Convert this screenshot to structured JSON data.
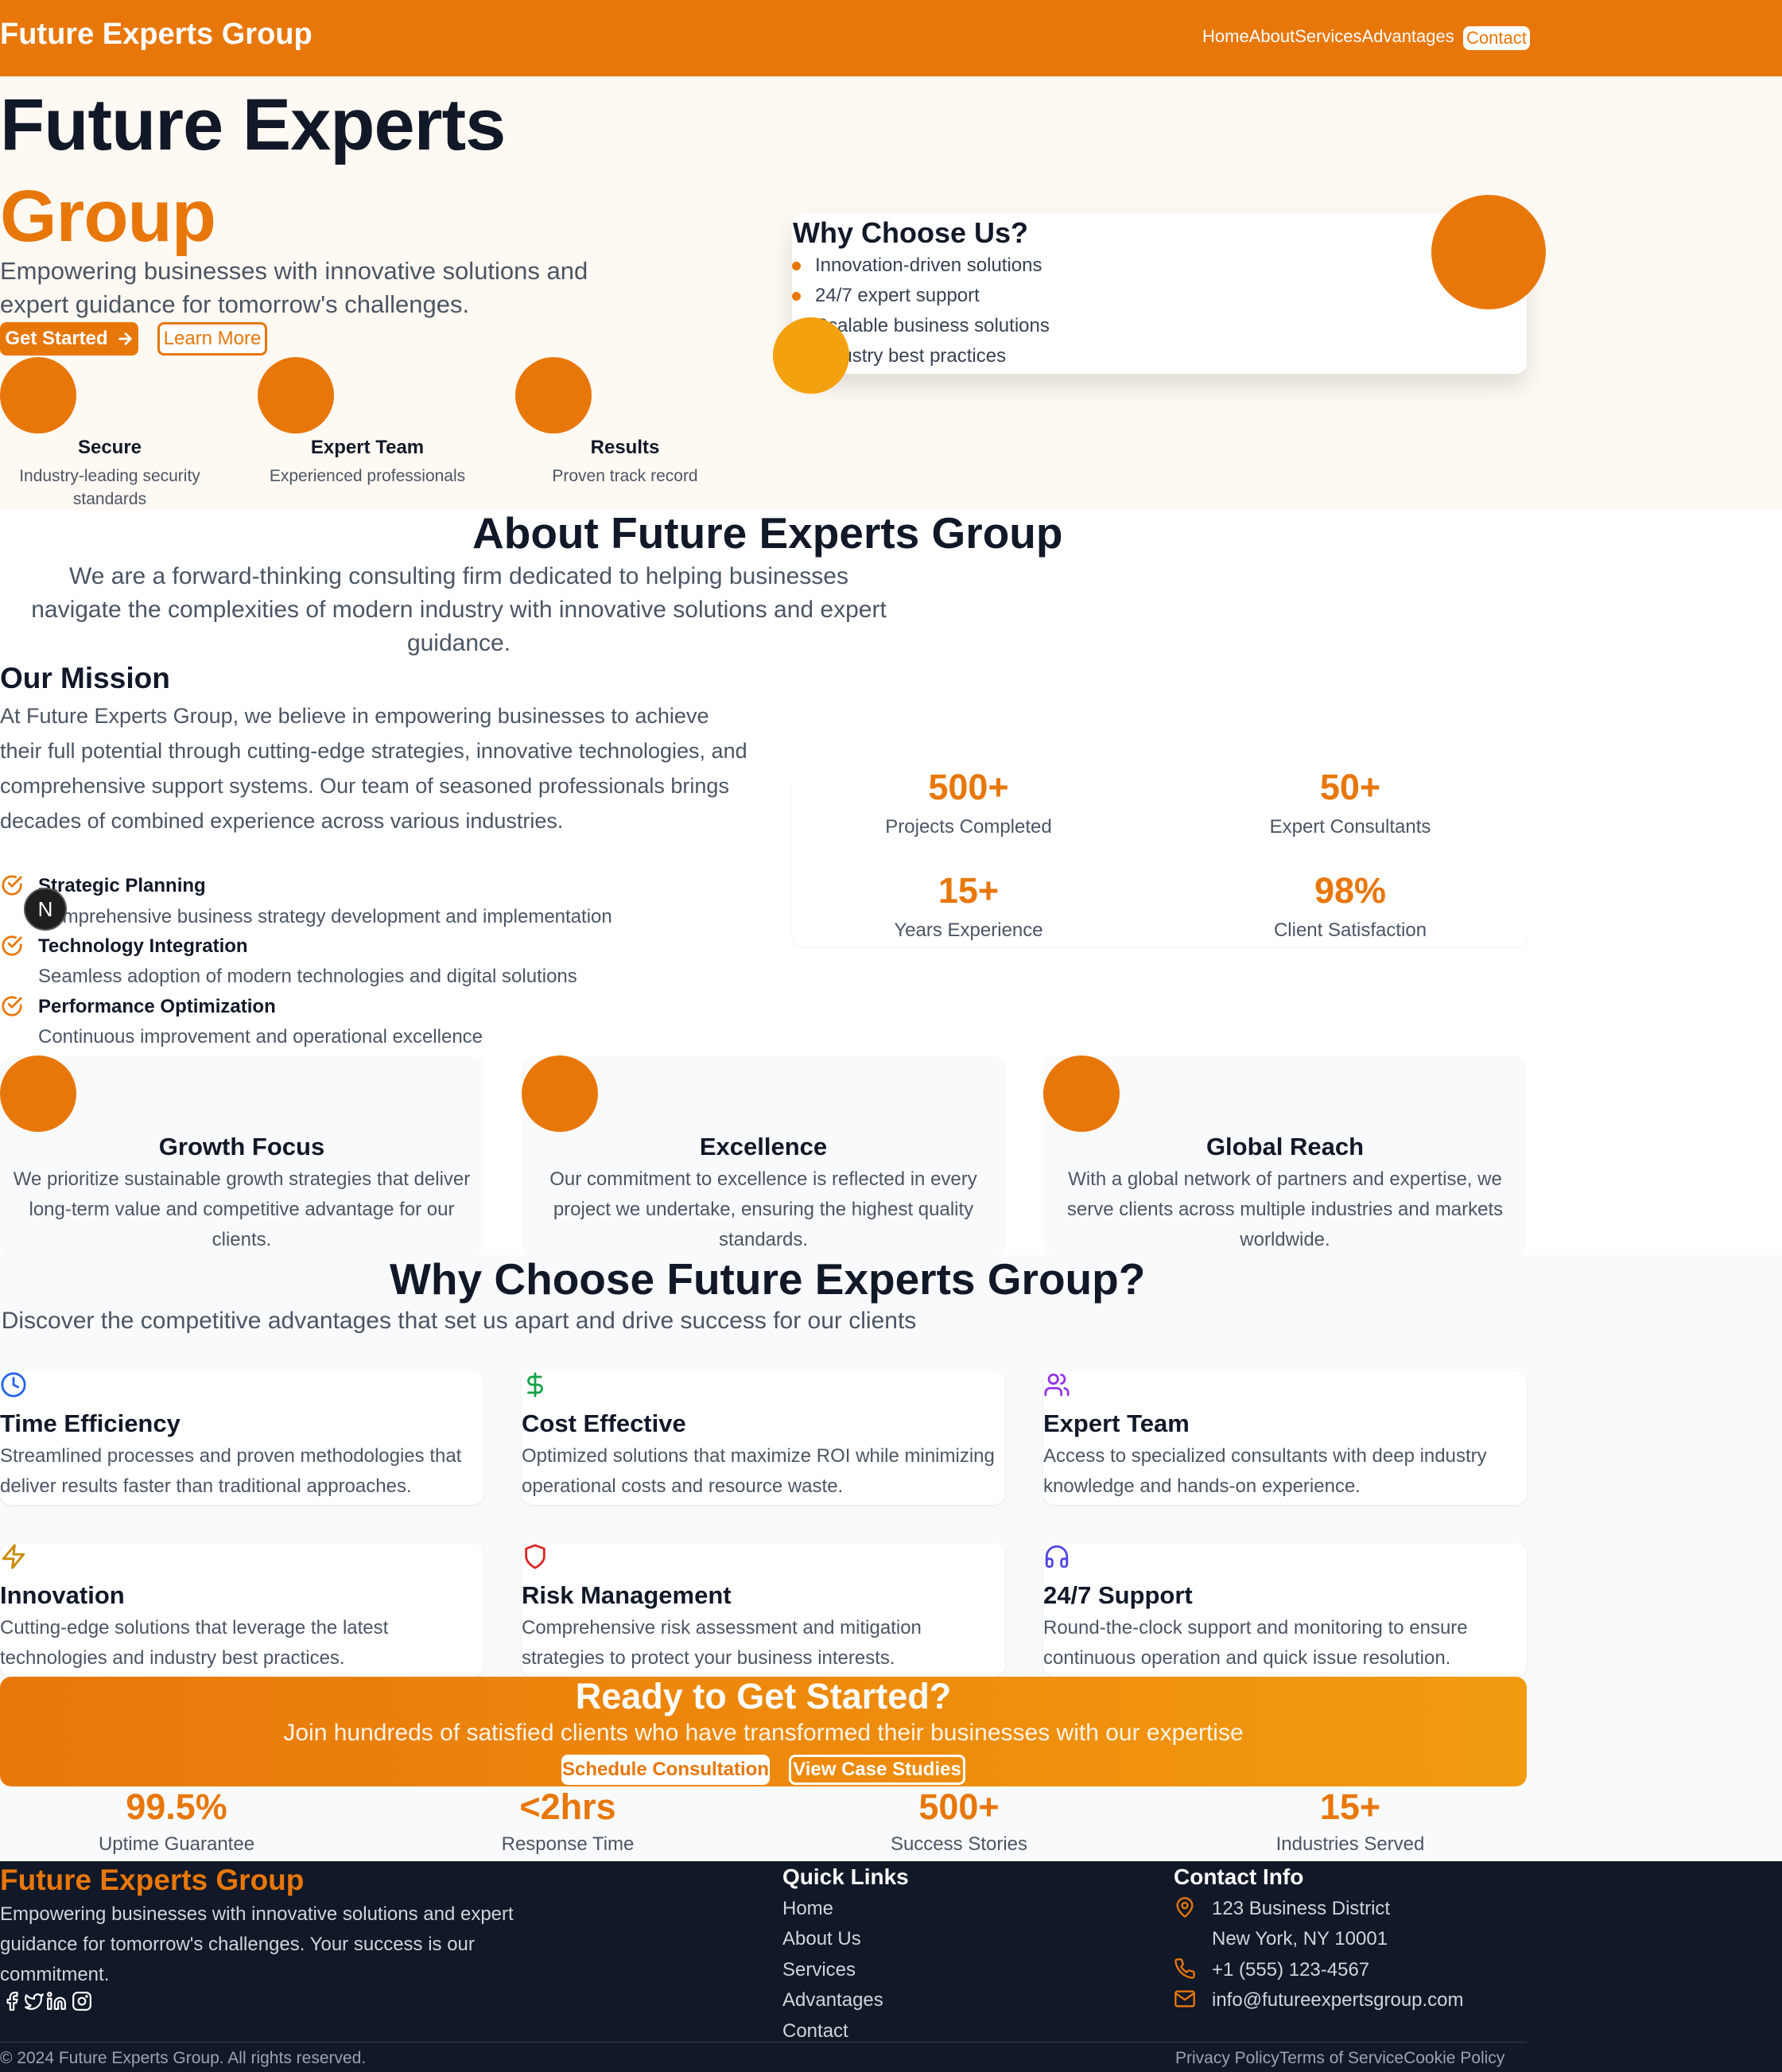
{
  "nav": {
    "brand": "Future Experts Group",
    "links": [
      "Home",
      "About",
      "Services",
      "Advantages"
    ],
    "contact": "Contact"
  },
  "hero": {
    "title_line1": "Future Experts",
    "title_line2": "Group",
    "subtitle": "Empowering businesses with innovative solutions and expert guidance for tomorrow's challenges.",
    "primary_button": "Get Started",
    "secondary_button": "Learn More",
    "features": [
      {
        "title": "Secure",
        "desc": "Industry-leading security standards"
      },
      {
        "title": "Expert Team",
        "desc": "Experienced professionals"
      },
      {
        "title": "Results",
        "desc": "Proven track record"
      }
    ],
    "why_card": {
      "title": "Why Choose Us?",
      "items": [
        "Innovation-driven solutions",
        "24/7 expert support",
        "Scalable business solutions",
        "Industry best practices"
      ]
    }
  },
  "about": {
    "title": "About Future Experts Group",
    "lead": "We are a forward-thinking consulting firm dedicated to helping businesses navigate the complexities of modern industry with innovative solutions and expert guidance.",
    "mission_title": "Our Mission",
    "mission_text": "At Future Experts Group, we believe in empowering businesses to achieve their full potential through cutting-edge strategies, innovative technologies, and comprehensive support systems. Our team of seasoned professionals brings decades of combined experience across various industries.",
    "list": [
      {
        "title": "Strategic Planning",
        "desc": "Comprehensive business strategy development and implementation"
      },
      {
        "title": "Technology Integration",
        "desc": "Seamless adoption of modern technologies and digital solutions"
      },
      {
        "title": "Performance Optimization",
        "desc": "Continuous improvement and operational excellence"
      }
    ],
    "stats": [
      {
        "value": "500+",
        "label": "Projects Completed"
      },
      {
        "value": "50+",
        "label": "Expert Consultants"
      },
      {
        "value": "15+",
        "label": "Years Experience"
      },
      {
        "value": "98%",
        "label": "Client Satisfaction"
      }
    ],
    "values": [
      {
        "title": "Growth Focus",
        "desc": "We prioritize sustainable growth strategies that deliver long-term value and competitive advantage for our clients."
      },
      {
        "title": "Excellence",
        "desc": "Our commitment to excellence is reflected in every project we undertake, ensuring the highest quality standards."
      },
      {
        "title": "Global Reach",
        "desc": "With a global network of partners and expertise, we serve clients across multiple industries and markets worldwide."
      }
    ]
  },
  "advantages": {
    "title": "Why Choose Future Experts Group?",
    "lead": "Discover the competitive advantages that set us apart and drive success for our clients",
    "cards": [
      {
        "icon": "clock-icon",
        "color": "#2563eb",
        "title": "Time Efficiency",
        "desc": "Streamlined processes and proven methodologies that deliver results faster than traditional approaches."
      },
      {
        "icon": "dollar-icon",
        "color": "#16a34a",
        "title": "Cost Effective",
        "desc": "Optimized solutions that maximize ROI while minimizing operational costs and resource waste."
      },
      {
        "icon": "users-icon",
        "color": "#9333ea",
        "title": "Expert Team",
        "desc": "Access to specialized consultants with deep industry knowledge and hands-on experience."
      },
      {
        "icon": "zap-icon",
        "color": "#ca8a04",
        "title": "Innovation",
        "desc": "Cutting-edge solutions that leverage the latest technologies and industry best practices."
      },
      {
        "icon": "shield-icon",
        "color": "#dc2626",
        "title": "Risk Management",
        "desc": "Comprehensive risk assessment and mitigation strategies to protect your business interests."
      },
      {
        "icon": "headphones-icon",
        "color": "#4f46e5",
        "title": "24/7 Support",
        "desc": "Round-the-clock support and monitoring to ensure continuous operation and quick issue resolution."
      }
    ]
  },
  "cta": {
    "title": "Ready to Get Started?",
    "subtitle": "Join hundreds of satisfied clients who have transformed their businesses with our expertise",
    "primary": "Schedule Consultation",
    "secondary": "View Case Studies"
  },
  "metrics": [
    {
      "value": "99.5%",
      "label": "Uptime Guarantee"
    },
    {
      "value": "<2hrs",
      "label": "Response Time"
    },
    {
      "value": "500+",
      "label": "Success Stories"
    },
    {
      "value": "15+",
      "label": "Industries Served"
    }
  ],
  "footer": {
    "brand": "Future Experts Group",
    "desc": "Empowering businesses with innovative solutions and expert guidance for tomorrow's challenges. Your success is our commitment.",
    "quick_links_title": "Quick Links",
    "quick_links": [
      "Home",
      "About Us",
      "Services",
      "Advantages",
      "Contact"
    ],
    "contact_title": "Contact Info",
    "address_line1": "123 Business District",
    "address_line2": "New York, NY 10001",
    "phone": "+1 (555) 123-4567",
    "email": "info@futureexpertsgroup.com",
    "copyright": "© 2024 Future Experts Group. All rights reserved.",
    "legal": [
      "Privacy Policy",
      "Terms of Service",
      "Cookie Policy"
    ],
    "social": [
      "facebook-icon",
      "twitter-icon",
      "linkedin-icon",
      "instagram-icon"
    ]
  },
  "overlay_badge": "N",
  "colors": {
    "accent": "#e8770a",
    "accent_light": "#f29b0f",
    "dark": "#111827"
  }
}
